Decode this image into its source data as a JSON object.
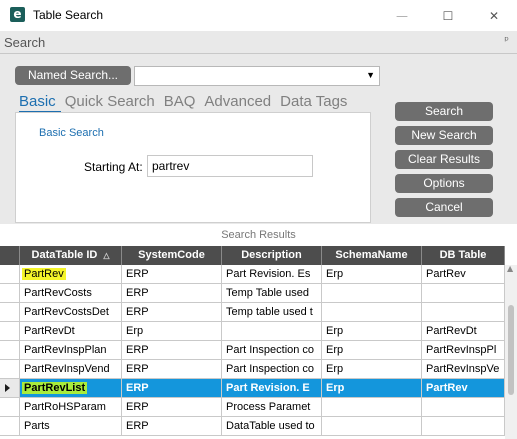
{
  "window": {
    "title": "Table Search",
    "app_icon_letter": "e",
    "minimize_glyph": "—",
    "maximize_glyph": "☐",
    "close_glyph": "✕"
  },
  "search_panel": {
    "header": "Search",
    "pin_glyph": "ᵖ",
    "named_search_button": "Named Search...",
    "named_search_value": "",
    "dropdown_glyph": "▼",
    "tabs": [
      {
        "label": "Basic",
        "active": true
      },
      {
        "label": "Quick Search",
        "active": false
      },
      {
        "label": "BAQ",
        "active": false
      },
      {
        "label": "Advanced",
        "active": false
      },
      {
        "label": "Data Tags",
        "active": false
      }
    ],
    "basic_search_label": "Basic Search",
    "starting_at_label": "Starting At:",
    "starting_at_value": "partrev"
  },
  "buttons": {
    "search": "Search",
    "new_search": "New Search",
    "clear_results": "Clear Results",
    "options": "Options",
    "cancel": "Cancel"
  },
  "results": {
    "title": "Search Results",
    "sort_glyph": "△",
    "columns": [
      "DataTable ID",
      "SystemCode",
      "Description",
      "SchemaName",
      "DB Table"
    ],
    "rows": [
      {
        "id": "PartRev",
        "system": "ERP",
        "desc": "Part Revision.  Es",
        "schema": "Erp",
        "db": "PartRev",
        "highlight": true,
        "selected": false
      },
      {
        "id": "PartRevCosts",
        "system": "ERP",
        "desc": "Temp Table used",
        "schema": "",
        "db": "",
        "highlight": false,
        "selected": false
      },
      {
        "id": "PartRevCostsDet",
        "system": "ERP",
        "desc": "Temp table used t",
        "schema": "",
        "db": "",
        "highlight": false,
        "selected": false
      },
      {
        "id": "PartRevDt",
        "system": "Erp",
        "desc": "",
        "schema": "Erp",
        "db": "PartRevDt",
        "highlight": false,
        "selected": false
      },
      {
        "id": "PartRevInspPlan",
        "system": "ERP",
        "desc": "Part Inspection co",
        "schema": "Erp",
        "db": "PartRevInspPl",
        "highlight": false,
        "selected": false
      },
      {
        "id": "PartRevInspVend",
        "system": "ERP",
        "desc": "Part Inspection co",
        "schema": "Erp",
        "db": "PartRevInspVe",
        "highlight": false,
        "selected": false
      },
      {
        "id": "PartRevList",
        "system": "ERP",
        "desc": "Part Revision.  E",
        "schema": "Erp",
        "db": "PartRev",
        "highlight": true,
        "selected": true
      },
      {
        "id": "PartRoHSParam",
        "system": "ERP",
        "desc": "Process Paramet",
        "schema": "",
        "db": "",
        "highlight": false,
        "selected": false
      },
      {
        "id": "Parts",
        "system": "ERP",
        "desc": "DataTable used to",
        "schema": "",
        "db": "",
        "highlight": false,
        "selected": false
      }
    ]
  },
  "colors": {
    "accent_blue": "#1d6fb0",
    "selection_blue": "#1496dc",
    "button_gray": "#6e6e6e",
    "header_gray": "#4d4d4d",
    "highlight_yellow": "#f5f52a"
  }
}
